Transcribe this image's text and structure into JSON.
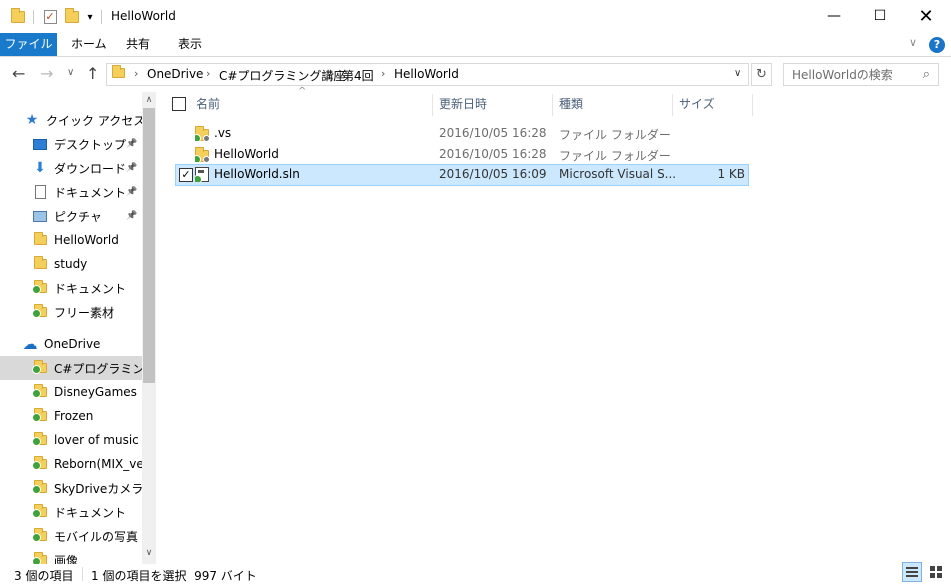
{
  "window": {
    "title": "HelloWorld"
  },
  "ribbon": {
    "tabs": [
      "ファイル",
      "ホーム",
      "共有",
      "表示"
    ]
  },
  "address": {
    "crumbs": [
      "OneDrive",
      "C#プログラミング講座",
      "第4回",
      "HelloWorld"
    ]
  },
  "search": {
    "placeholder": "HelloWorldの検索"
  },
  "nav": {
    "quick_access": "クイック アクセス",
    "quick_items": [
      {
        "label": "デスクトップ",
        "pinned": true
      },
      {
        "label": "ダウンロード",
        "pinned": true
      },
      {
        "label": "ドキュメント",
        "pinned": true
      },
      {
        "label": "ピクチャ",
        "pinned": true
      },
      {
        "label": "HelloWorld"
      },
      {
        "label": "study"
      },
      {
        "label": "ドキュメント"
      },
      {
        "label": "フリー素材"
      }
    ],
    "onedrive": "OneDrive",
    "onedrive_items": [
      {
        "label": "C#プログラミング講座",
        "selected": true
      },
      {
        "label": "DisneyGames"
      },
      {
        "label": "Frozen"
      },
      {
        "label": "lover of music"
      },
      {
        "label": "Reborn(MIX_ver)"
      },
      {
        "label": "SkyDriveカメラロール"
      },
      {
        "label": "ドキュメント"
      },
      {
        "label": "モバイルの写真"
      },
      {
        "label": "画像"
      }
    ]
  },
  "columns": {
    "name": "名前",
    "date": "更新日時",
    "type": "種類",
    "size": "サイズ"
  },
  "files": [
    {
      "name": ".vs",
      "date": "2016/10/05 16:28",
      "type": "ファイル フォルダー",
      "size": ""
    },
    {
      "name": "HelloWorld",
      "date": "2016/10/05 16:28",
      "type": "ファイル フォルダー",
      "size": ""
    },
    {
      "name": "HelloWorld.sln",
      "date": "2016/10/05 16:09",
      "type": "Microsoft Visual S...",
      "size": "1 KB"
    }
  ],
  "status": {
    "count": "3 個の項目",
    "selection": "1 個の項目を選択  997 バイト"
  },
  "colors": {
    "accent": "#1979ca",
    "selection": "#cce8ff",
    "folder": "#f4d05a",
    "sync_ok": "#3ea33a"
  }
}
